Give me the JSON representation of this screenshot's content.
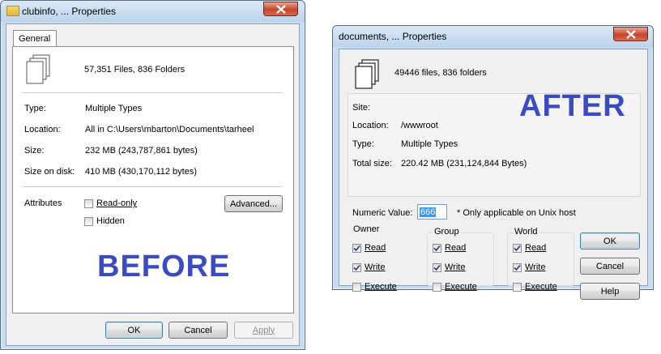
{
  "before": {
    "title": "clubinfo, ... Properties",
    "tab": "General",
    "summary": "57,351 Files, 836 Folders",
    "fields": [
      {
        "label": "Type:",
        "value": "Multiple Types"
      },
      {
        "label": "Location:",
        "value": "All in C:\\Users\\mbarton\\Documents\\tarheel"
      },
      {
        "label": "Size:",
        "value": "232 MB (243,787,861 bytes)"
      },
      {
        "label": "Size on disk:",
        "value": "410 MB (430,170,112 bytes)"
      }
    ],
    "attributes_label": "Attributes",
    "readonly_label": "Read-only",
    "hidden_label": "Hidden",
    "advanced_label": "Advanced...",
    "ok_label": "OK",
    "cancel_label": "Cancel",
    "apply_label": "Apply",
    "stamp": "BEFORE"
  },
  "after": {
    "title": "documents, ... Properties",
    "summary": "49446 files, 836 folders",
    "fields": [
      {
        "label": "Site:",
        "value": ""
      },
      {
        "label": "Location:",
        "value": "/wwwroot"
      },
      {
        "label": "Type:",
        "value": "Multiple Types"
      },
      {
        "label": "Total size:",
        "value": "220.42 MB (231,124,844 Bytes)"
      }
    ],
    "numeric_label": "Numeric Value:",
    "numeric_value": "666",
    "numeric_note": "* Only applicable on Unix host",
    "groups": [
      {
        "name": "Owner",
        "read": "Read",
        "write": "Write",
        "execute": "Execute",
        "read_checked": true,
        "write_checked": true,
        "execute_checked": false
      },
      {
        "name": "Group",
        "read": "Read",
        "write": "Write",
        "execute": "Execute",
        "read_checked": true,
        "write_checked": true,
        "execute_checked": false
      },
      {
        "name": "World",
        "read": "Read",
        "write": "Write",
        "execute": "Execute",
        "read_checked": true,
        "write_checked": true,
        "execute_checked": false
      }
    ],
    "ok_label": "OK",
    "cancel_label": "Cancel",
    "help_label": "Help",
    "stamp": "AFTER"
  },
  "colors": {
    "stamp": "#3a4bc4",
    "titlebar": "#c7dcef",
    "dialog_bg": "#f0f0f0",
    "close_button": "#c7452c",
    "input_highlight": "#3399ff"
  },
  "icons": [
    "files-icon",
    "folder-icon",
    "close-icon",
    "check-icon"
  ]
}
